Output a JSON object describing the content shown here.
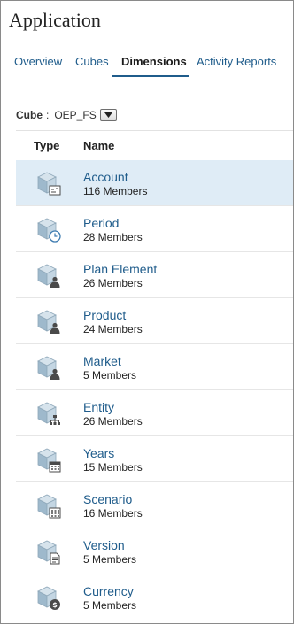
{
  "app": {
    "title": "Application"
  },
  "tabs": [
    {
      "label": "Overview",
      "active": false
    },
    {
      "label": "Cubes",
      "active": false
    },
    {
      "label": "Dimensions",
      "active": true
    },
    {
      "label": "Activity Reports",
      "active": false
    }
  ],
  "cube_selector": {
    "label": "Cube",
    "separator": ":",
    "value": "OEP_FS",
    "dropdown_icon": "chevron-down-icon"
  },
  "table": {
    "headers": {
      "type": "Type",
      "name": "Name"
    },
    "rows": [
      {
        "name": "Account",
        "members": "116 Members",
        "badge": "account-badge",
        "selected": true
      },
      {
        "name": "Period",
        "members": "28 Members",
        "badge": "clock-badge",
        "selected": false
      },
      {
        "name": "Plan Element",
        "members": "26 Members",
        "badge": "person-badge",
        "selected": false
      },
      {
        "name": "Product",
        "members": "24 Members",
        "badge": "person-badge",
        "selected": false
      },
      {
        "name": "Market",
        "members": "5 Members",
        "badge": "person-badge",
        "selected": false
      },
      {
        "name": "Entity",
        "members": "26 Members",
        "badge": "hierarchy-badge",
        "selected": false
      },
      {
        "name": "Years",
        "members": "15 Members",
        "badge": "calendar-badge",
        "selected": false
      },
      {
        "name": "Scenario",
        "members": "16 Members",
        "badge": "grid-badge",
        "selected": false
      },
      {
        "name": "Version",
        "members": "5 Members",
        "badge": "document-badge",
        "selected": false
      },
      {
        "name": "Currency",
        "members": "5 Members",
        "badge": "currency-badge",
        "selected": false
      }
    ]
  },
  "colors": {
    "link": "#1f5c8b",
    "selected_row": "#dfecf6",
    "cube_top": "#d6e3ec",
    "cube_left": "#9eb9cc",
    "cube_right": "#c4d6e3",
    "badge": "#4a4a4a"
  }
}
